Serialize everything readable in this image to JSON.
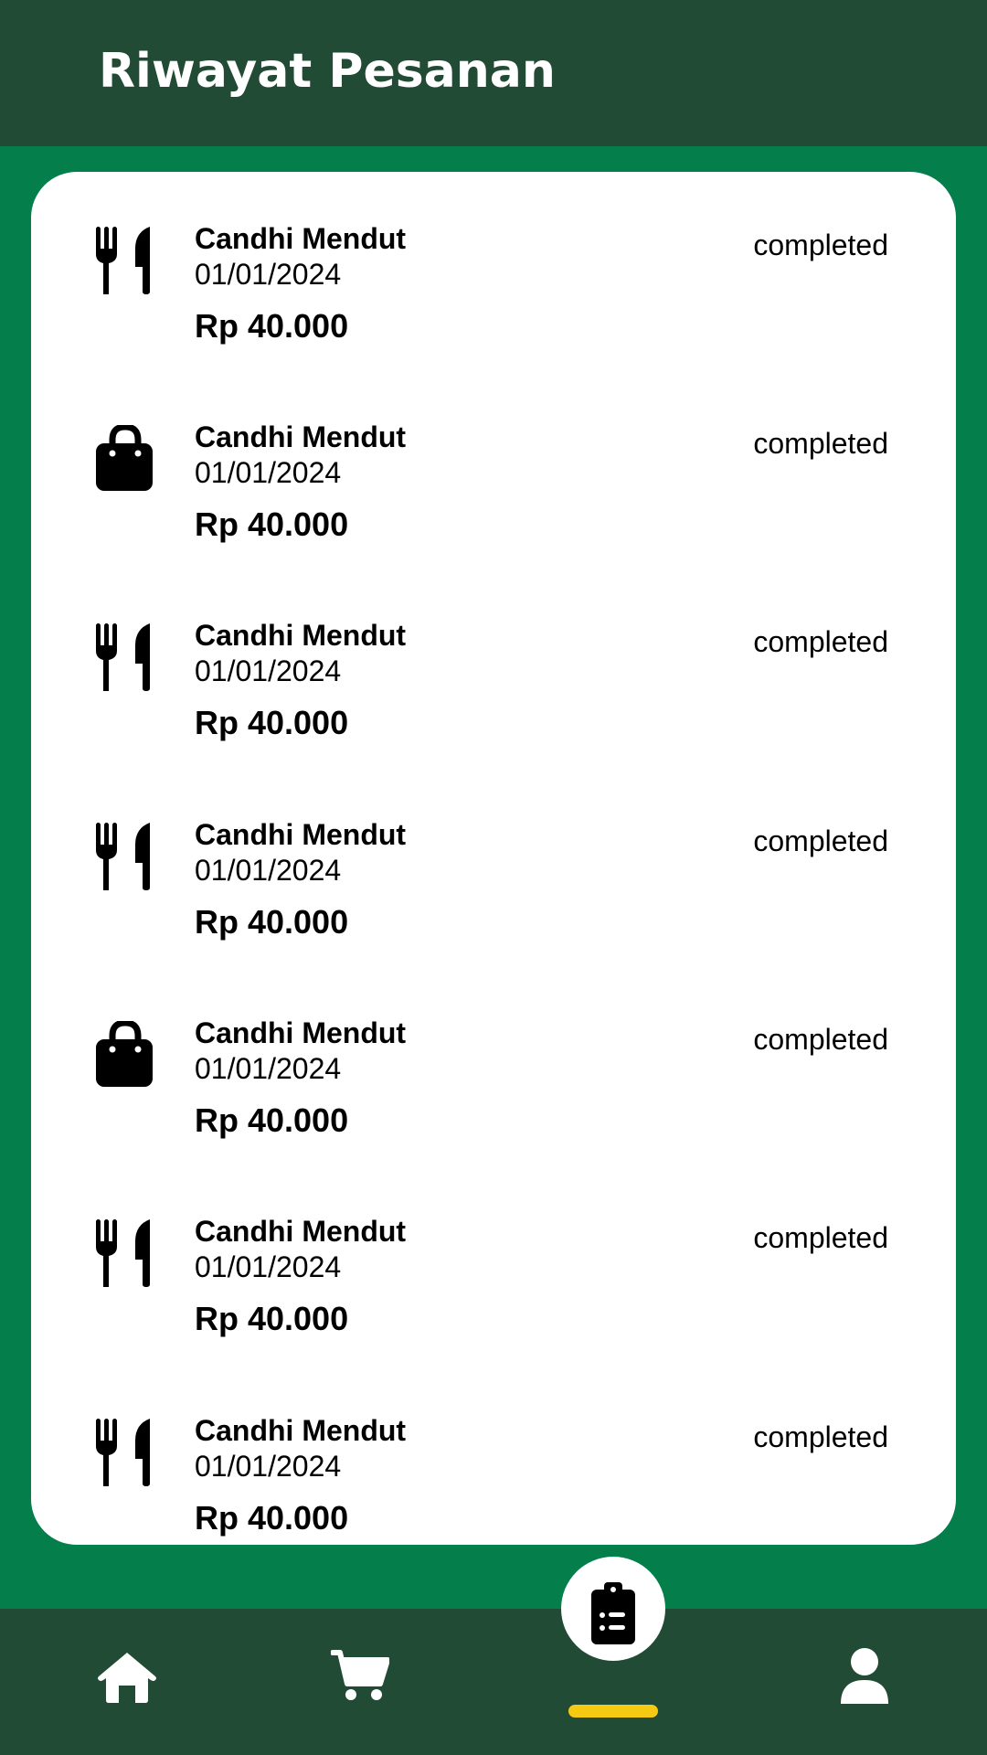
{
  "header": {
    "title": "Riwayat Pesanan"
  },
  "orders": [
    {
      "type_icon": "fork-knife-icon",
      "name": "Candhi Mendut",
      "date": "01/01/2024",
      "price": "Rp 40.000",
      "status": "completed"
    },
    {
      "type_icon": "shopping-bag-icon",
      "name": "Candhi Mendut",
      "date": "01/01/2024",
      "price": "Rp 40.000",
      "status": "completed"
    },
    {
      "type_icon": "fork-knife-icon",
      "name": "Candhi Mendut",
      "date": "01/01/2024",
      "price": "Rp 40.000",
      "status": "completed"
    },
    {
      "type_icon": "fork-knife-icon",
      "name": "Candhi Mendut",
      "date": "01/01/2024",
      "price": "Rp 40.000",
      "status": "completed"
    },
    {
      "type_icon": "shopping-bag-icon",
      "name": "Candhi Mendut",
      "date": "01/01/2024",
      "price": "Rp 40.000",
      "status": "completed"
    },
    {
      "type_icon": "fork-knife-icon",
      "name": "Candhi Mendut",
      "date": "01/01/2024",
      "price": "Rp 40.000",
      "status": "completed"
    },
    {
      "type_icon": "fork-knife-icon",
      "name": "Candhi Mendut",
      "date": "01/01/2024",
      "price": "Rp 40.000",
      "status": "completed"
    }
  ],
  "bottom_nav": {
    "items": [
      {
        "icon": "home-icon"
      },
      {
        "icon": "cart-icon"
      },
      {
        "icon": "clipboard-list-icon",
        "active": true
      },
      {
        "icon": "user-icon"
      }
    ]
  },
  "colors": {
    "header_bg": "#224b35",
    "page_bg": "#047e4b",
    "card_bg": "#ffffff",
    "active_indicator": "#f6c912"
  }
}
